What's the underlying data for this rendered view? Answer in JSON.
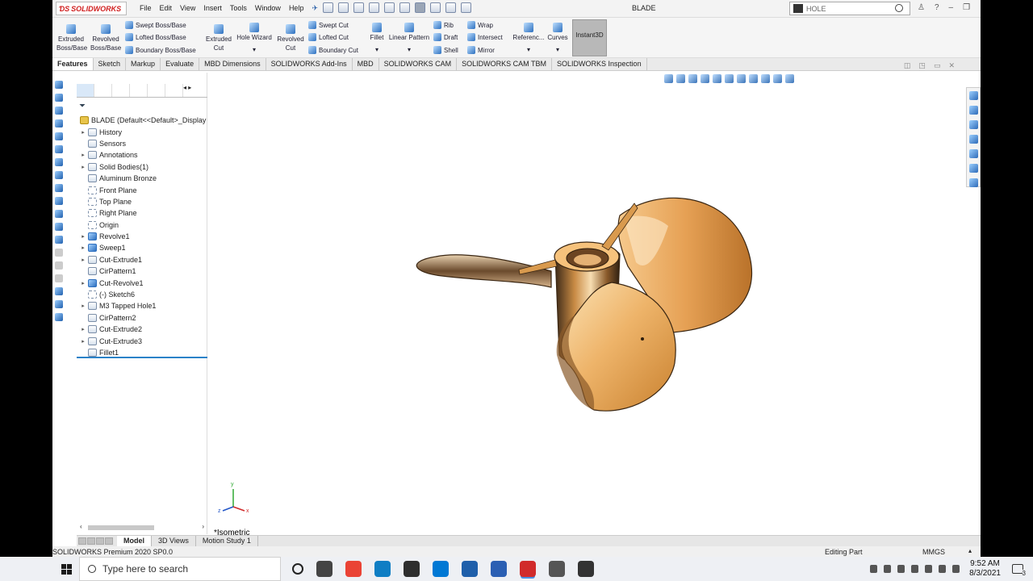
{
  "app": {
    "logo_text": "SOLIDWORKS",
    "doc_title": "BLADE",
    "search_value": "HOLE",
    "menu": [
      "File",
      "Edit",
      "View",
      "Insert",
      "Tools",
      "Window",
      "Help"
    ]
  },
  "ribbon": {
    "extruded_boss_base": [
      "Extruded",
      "Boss/Base"
    ],
    "revolved_boss_base": [
      "Revolved",
      "Boss/Base"
    ],
    "swept_boss_base": "Swept Boss/Base",
    "lofted_boss_base": "Lofted Boss/Base",
    "boundary_boss_base": "Boundary Boss/Base",
    "extruded_cut": [
      "Extruded",
      "Cut"
    ],
    "hole_wizard": "Hole Wizard",
    "revolved_cut": [
      "Revolved",
      "Cut"
    ],
    "swept_cut": "Swept Cut",
    "lofted_cut": "Lofted Cut",
    "boundary_cut": "Boundary Cut",
    "fillet": "Fillet",
    "linear_pattern": "Linear Pattern",
    "rib": "Rib",
    "draft": "Draft",
    "shell": "Shell",
    "wrap": "Wrap",
    "intersect": "Intersect",
    "mirror": "Mirror",
    "reference": "Referenc...",
    "curves": "Curves",
    "instant3d": "Instant3D"
  },
  "tabs": [
    "Features",
    "Sketch",
    "Markup",
    "Evaluate",
    "MBD Dimensions",
    "SOLIDWORKS Add-Ins",
    "MBD",
    "SOLIDWORKS CAM",
    "SOLIDWORKS CAM TBM",
    "SOLIDWORKS Inspection"
  ],
  "tree": [
    {
      "label": "BLADE  (Default<<Default>_Display",
      "arrow": "",
      "icon": "root"
    },
    {
      "label": "History",
      "arrow": "▸",
      "icon": "folder"
    },
    {
      "label": "Sensors",
      "arrow": "",
      "icon": "folder"
    },
    {
      "label": "Annotations",
      "arrow": "▸",
      "icon": "folder"
    },
    {
      "label": "Solid Bodies(1)",
      "arrow": "▸",
      "icon": "folder"
    },
    {
      "label": "Aluminum Bronze",
      "arrow": "",
      "icon": "folder"
    },
    {
      "label": "Front Plane",
      "arrow": "",
      "icon": "plane"
    },
    {
      "label": "Top Plane",
      "arrow": "",
      "icon": "plane"
    },
    {
      "label": "Right Plane",
      "arrow": "",
      "icon": "plane"
    },
    {
      "label": "Origin",
      "arrow": "",
      "icon": "plane"
    },
    {
      "label": "Revolve1",
      "arrow": "▸",
      "icon": "feat"
    },
    {
      "label": "Sweep1",
      "arrow": "▸",
      "icon": "feat"
    },
    {
      "label": "Cut-Extrude1",
      "arrow": "▸",
      "icon": "folder"
    },
    {
      "label": "CirPattern1",
      "arrow": "",
      "icon": "folder"
    },
    {
      "label": "Cut-Revolve1",
      "arrow": "▸",
      "icon": "feat"
    },
    {
      "label": "(-) Sketch6",
      "arrow": "",
      "icon": "plane"
    },
    {
      "label": "M3 Tapped Hole1",
      "arrow": "▸",
      "icon": "folder"
    },
    {
      "label": "CirPattern2",
      "arrow": "",
      "icon": "folder"
    },
    {
      "label": "Cut-Extrude2",
      "arrow": "▸",
      "icon": "folder"
    },
    {
      "label": "Cut-Extrude3",
      "arrow": "▸",
      "icon": "folder"
    },
    {
      "label": "Fillet1",
      "arrow": "",
      "icon": "folder"
    }
  ],
  "viewport": {
    "orientation": "*Isometric",
    "triad_x": "x",
    "triad_y": "y",
    "triad_z": "z"
  },
  "bottom_tabs": [
    "Model",
    "3D Views",
    "Motion Study 1"
  ],
  "status": {
    "version": "SOLIDWORKS Premium 2020 SP0.0",
    "mode": "Editing Part",
    "units": "MMGS"
  },
  "taskbar": {
    "search_placeholder": "Type here to search",
    "time": "9:52 AM",
    "date": "8/3/2021",
    "notif_count": "3",
    "pinned_colors": [
      "#444444",
      "#ea4335",
      "#0f7ec4",
      "#2e2e2e",
      "#0078d4",
      "#1f5faa",
      "#2b5fb3",
      "#d12b2b",
      "#555555",
      "#333333"
    ]
  },
  "colors": {
    "accent": "#2a82c8",
    "bronze": "#e09a3c"
  }
}
